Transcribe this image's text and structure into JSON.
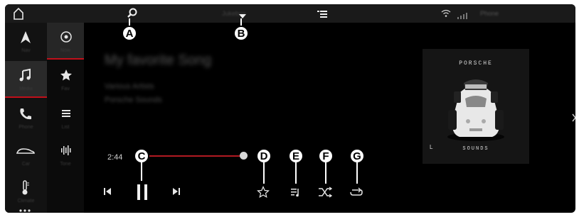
{
  "status_bar": {
    "source_label": "Jukebox",
    "phone_label": "Phone",
    "icons": [
      "home-icon",
      "search-icon",
      "dropdown-arrow-icon",
      "sort-list-icon",
      "wifi-icon",
      "signal-icon"
    ]
  },
  "left_nav": {
    "items": [
      {
        "name": "navigation",
        "icon": "navigation-arrow-icon",
        "label": "Nav"
      },
      {
        "name": "media",
        "icon": "music-note-icon",
        "label": "Media",
        "active": true
      },
      {
        "name": "phone",
        "icon": "phone-icon",
        "label": "Phone"
      },
      {
        "name": "car",
        "icon": "car-icon",
        "label": "Car"
      },
      {
        "name": "climate",
        "icon": "thermometer-icon",
        "label": "Climate"
      },
      {
        "name": "more",
        "icon": "more-dots-icon",
        "label": "…"
      }
    ]
  },
  "sub_nav": {
    "items": [
      {
        "name": "now-playing",
        "icon": "play-circle-icon",
        "label": "Now",
        "active": true
      },
      {
        "name": "favorites",
        "icon": "star-icon",
        "label": "Fav"
      },
      {
        "name": "list",
        "icon": "list-icon",
        "label": "List"
      },
      {
        "name": "sound",
        "icon": "equalizer-icon",
        "label": "Tone"
      }
    ]
  },
  "track": {
    "title": "My favorite Song",
    "artist": "Various Artists",
    "album": "Porsche Sounds"
  },
  "playback": {
    "elapsed": "2:44",
    "progress_fraction": 0.22
  },
  "album_art": {
    "brand": "PORSCHE",
    "subtitle": "SOUNDS",
    "mark": "L"
  },
  "callouts": {
    "a": "A",
    "b": "B",
    "c": "C",
    "d": "D",
    "e": "E",
    "f": "F",
    "g": "G"
  },
  "colors": {
    "accent": "#c10f1a",
    "background": "#000000",
    "icon": "#e6e6e6"
  }
}
